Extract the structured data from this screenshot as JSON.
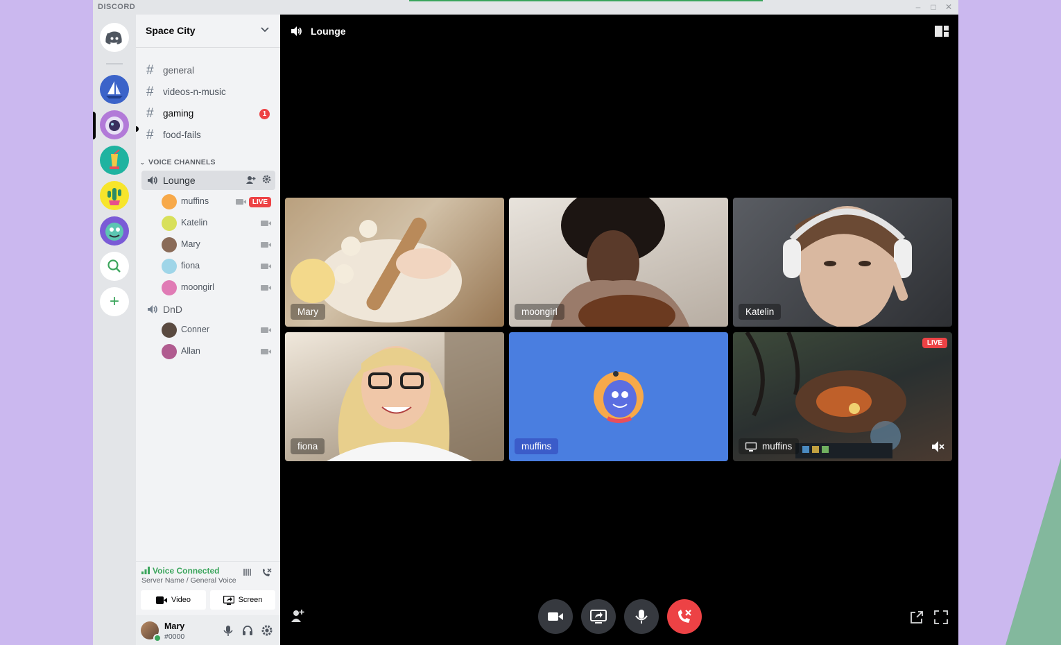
{
  "app": {
    "brand": "DISCORD"
  },
  "server": {
    "name": "Space City"
  },
  "text_channels": [
    {
      "name": "general",
      "unread": false
    },
    {
      "name": "videos-n-music",
      "unread": false
    },
    {
      "name": "gaming",
      "unread": true,
      "mentions": "1"
    },
    {
      "name": "food-fails",
      "unread": false
    }
  ],
  "voice_category": "VOICE CHANNELS",
  "voice_channels": {
    "lounge": {
      "name": "Lounge",
      "members": [
        {
          "name": "muffins",
          "live": "LIVE",
          "color": "#f7a94a"
        },
        {
          "name": "Katelin",
          "color": "#d8e05a"
        },
        {
          "name": "Mary",
          "color": "#8a6b58"
        },
        {
          "name": "fiona",
          "color": "#9fd5e8"
        },
        {
          "name": "moongirl",
          "color": "#e07bb5"
        }
      ]
    },
    "dnd": {
      "name": "DnD",
      "members": [
        {
          "name": "Conner",
          "color": "#5a4a40"
        },
        {
          "name": "Allan",
          "color": "#b05b8f"
        }
      ]
    }
  },
  "voice_panel": {
    "status": "Voice Connected",
    "subtitle": "Server Name / General Voice",
    "video_label": "Video",
    "screen_label": "Screen"
  },
  "user": {
    "name": "Mary",
    "tag": "#0000"
  },
  "stage": {
    "title": "Lounge",
    "tiles": [
      {
        "name": "Mary"
      },
      {
        "name": "moongirl"
      },
      {
        "name": "Katelin"
      },
      {
        "name": "fiona"
      },
      {
        "name": "muffins"
      },
      {
        "name": "muffins",
        "live": "LIVE"
      }
    ]
  },
  "colors": {
    "accent": "#5865f2",
    "blurple_tile": "#4a7ee0",
    "danger": "#ed4245",
    "online": "#3ba55c"
  }
}
